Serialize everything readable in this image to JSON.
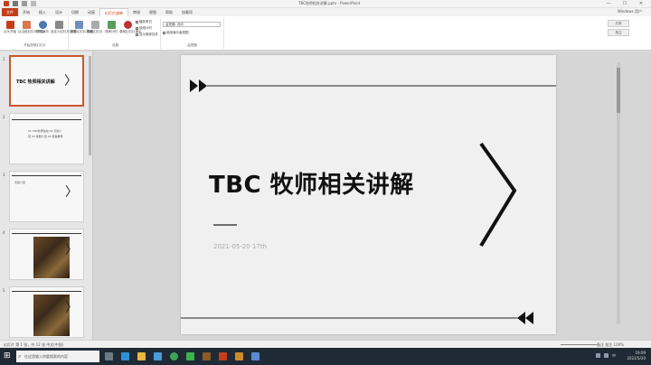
{
  "window": {
    "title": "TBC牧师相关讲解.pptx - PowerPoint",
    "min": "—",
    "max": "☐",
    "close": "✕"
  },
  "ribbon": {
    "tabs": [
      "文件",
      "开始",
      "插入",
      "设计",
      "切换",
      "动画",
      "幻灯片放映",
      "审阅",
      "视图",
      "帮助",
      "加载项"
    ],
    "active_tab": "幻灯片放映",
    "user": "Windows 用户",
    "groups": [
      {
        "label": "开始放映幻灯片",
        "buttons": [
          "从头开始",
          "从当前幻灯片开始",
          "联机演示",
          "自定义幻灯片放映"
        ]
      },
      {
        "label": "设置",
        "buttons": [
          "设置幻灯片放映",
          "隐藏幻灯片",
          "排练计时",
          "录制幻灯片演示"
        ]
      },
      {
        "label": "监视器",
        "buttons": []
      }
    ],
    "checkboxes": [
      "播放旁白",
      "使用计时",
      "显示媒体控件"
    ],
    "monitor_label": "监视器:",
    "monitor_value": "自动",
    "presenter_view": "使用演示者视图",
    "side_buttons": [
      "共享",
      "批注"
    ]
  },
  "thumbnails": {
    "items": [
      {
        "num": "1",
        "text": "TBC 牧师相关讲解",
        "kind": "title"
      },
      {
        "num": "2",
        "text": "01 TBC牧师改动  02 天赋介绍  03 技能介绍  04 装备推荐",
        "kind": "list"
      },
      {
        "num": "3",
        "text": "天赋介绍",
        "kind": "text"
      },
      {
        "num": "4",
        "text": "",
        "kind": "photo"
      },
      {
        "num": "5",
        "text": "",
        "kind": "photo"
      }
    ]
  },
  "slide": {
    "title": "TBC 牧师相关讲解",
    "date": "2021-05-20  17th"
  },
  "status": {
    "left": "幻灯片 第 1 张，共 12 张    中文(中国)",
    "right": "备注    批注        100%"
  },
  "taskbar": {
    "search_placeholder": "在这里输入你要搜索的内容",
    "time": "19:09",
    "date": "2021/5/20",
    "lang": "中"
  }
}
